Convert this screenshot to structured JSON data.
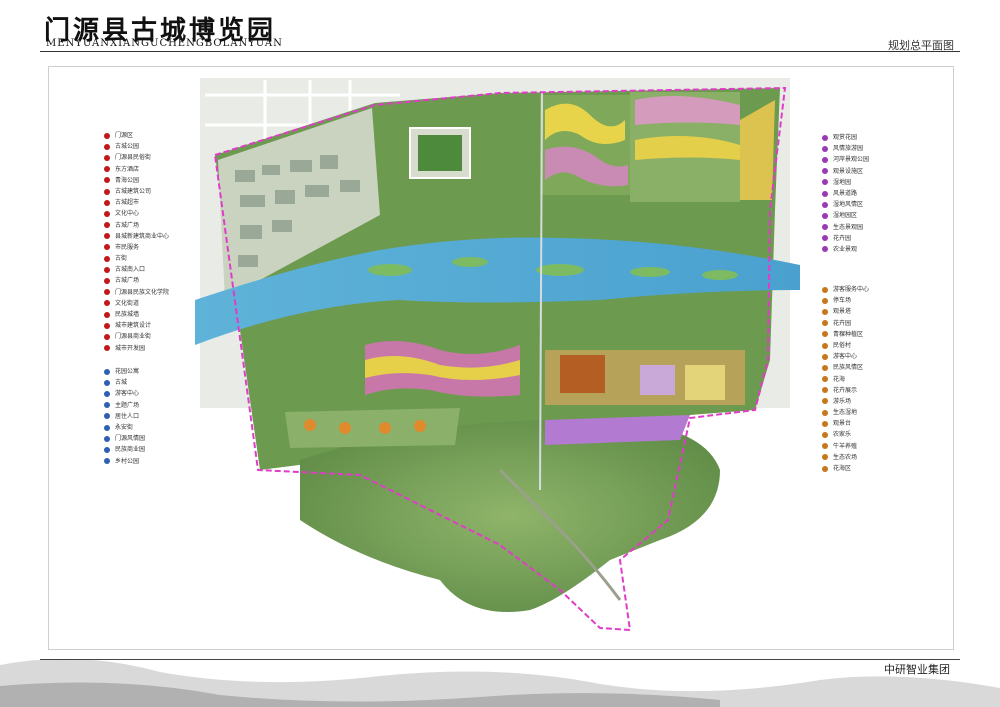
{
  "header": {
    "title": "门源县古城博览园",
    "subtitle": "MENYUANXIANGUCHENGBOLANYUAN",
    "plan_name": "规划总平面图"
  },
  "footer": {
    "company": "中研智业集团"
  },
  "legend_left_red": {
    "color": "#c0181b",
    "items": [
      "门源区",
      "古城公园",
      "门源县民俗街",
      "东方酒店",
      "青海公园",
      "古城建筑公司",
      "古城超市",
      "文化中心",
      "古城广场",
      "县城新建筑商业中心",
      "市民服务",
      "古街",
      "古城南入口",
      "古城广场",
      "门源县民族文化学院",
      "文化街道",
      "民族城墙",
      "城市建筑设计",
      "门源县商业街",
      "城市开发园"
    ]
  },
  "legend_left_blue": {
    "color": "#2d5fb4",
    "items": [
      "花园公寓",
      "古城",
      "游客中心",
      "主题广场",
      "居住人口",
      "永安街",
      "门源风情园",
      "民族商业园",
      "乡村公园"
    ]
  },
  "legend_right_purple": {
    "color": "#9b39b4",
    "items": [
      "观赏花园",
      "风情旅游园",
      "河岸景观公园",
      "观景设施区",
      "湿地园",
      "风景道路",
      "湿地风情区",
      "湿地园区",
      "生态景观园",
      "花卉园",
      "农业景观"
    ]
  },
  "legend_right_orange": {
    "color": "#c8761a",
    "items": [
      "游客服务中心",
      "停车场",
      "观景塔",
      "花卉园",
      "青稞种植区",
      "民俗村",
      "游客中心",
      "民族风情区",
      "花海",
      "花卉展示",
      "游乐场",
      "生态湿地",
      "观景台",
      "农家乐",
      "牛羊养殖",
      "生态农场",
      "花海区"
    ]
  }
}
